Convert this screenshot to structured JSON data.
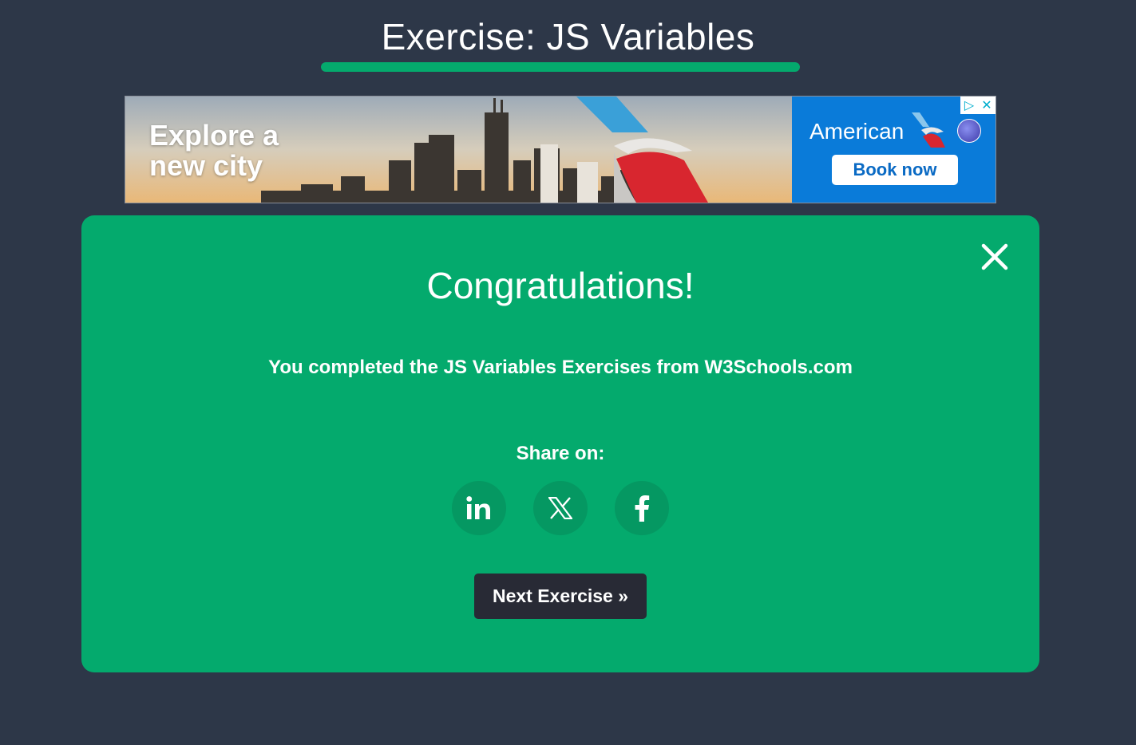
{
  "header": {
    "title": "Exercise: JS Variables",
    "progress_fraction": 1.0
  },
  "ad": {
    "headline_line1": "Explore a",
    "headline_line2": "new city",
    "brand": "American",
    "cta_label": "Book now",
    "adchoices_icon": "▷",
    "close_icon": "✕"
  },
  "modal": {
    "heading": "Congratulations!",
    "message": "You completed the JS Variables Exercises from W3Schools.com",
    "share_label": "Share on:",
    "share_buttons": [
      {
        "icon": "linkedin-icon",
        "label": "in"
      },
      {
        "icon": "x-icon",
        "label": "𝕏"
      },
      {
        "icon": "facebook-icon",
        "label": "f"
      }
    ],
    "next_label": "Next Exercise »"
  },
  "colors": {
    "page_bg": "#2d3748",
    "accent_green": "#04aa6d",
    "share_circle": "#059862",
    "next_button": "#282a35",
    "ad_blue": "#0a7bd9"
  }
}
